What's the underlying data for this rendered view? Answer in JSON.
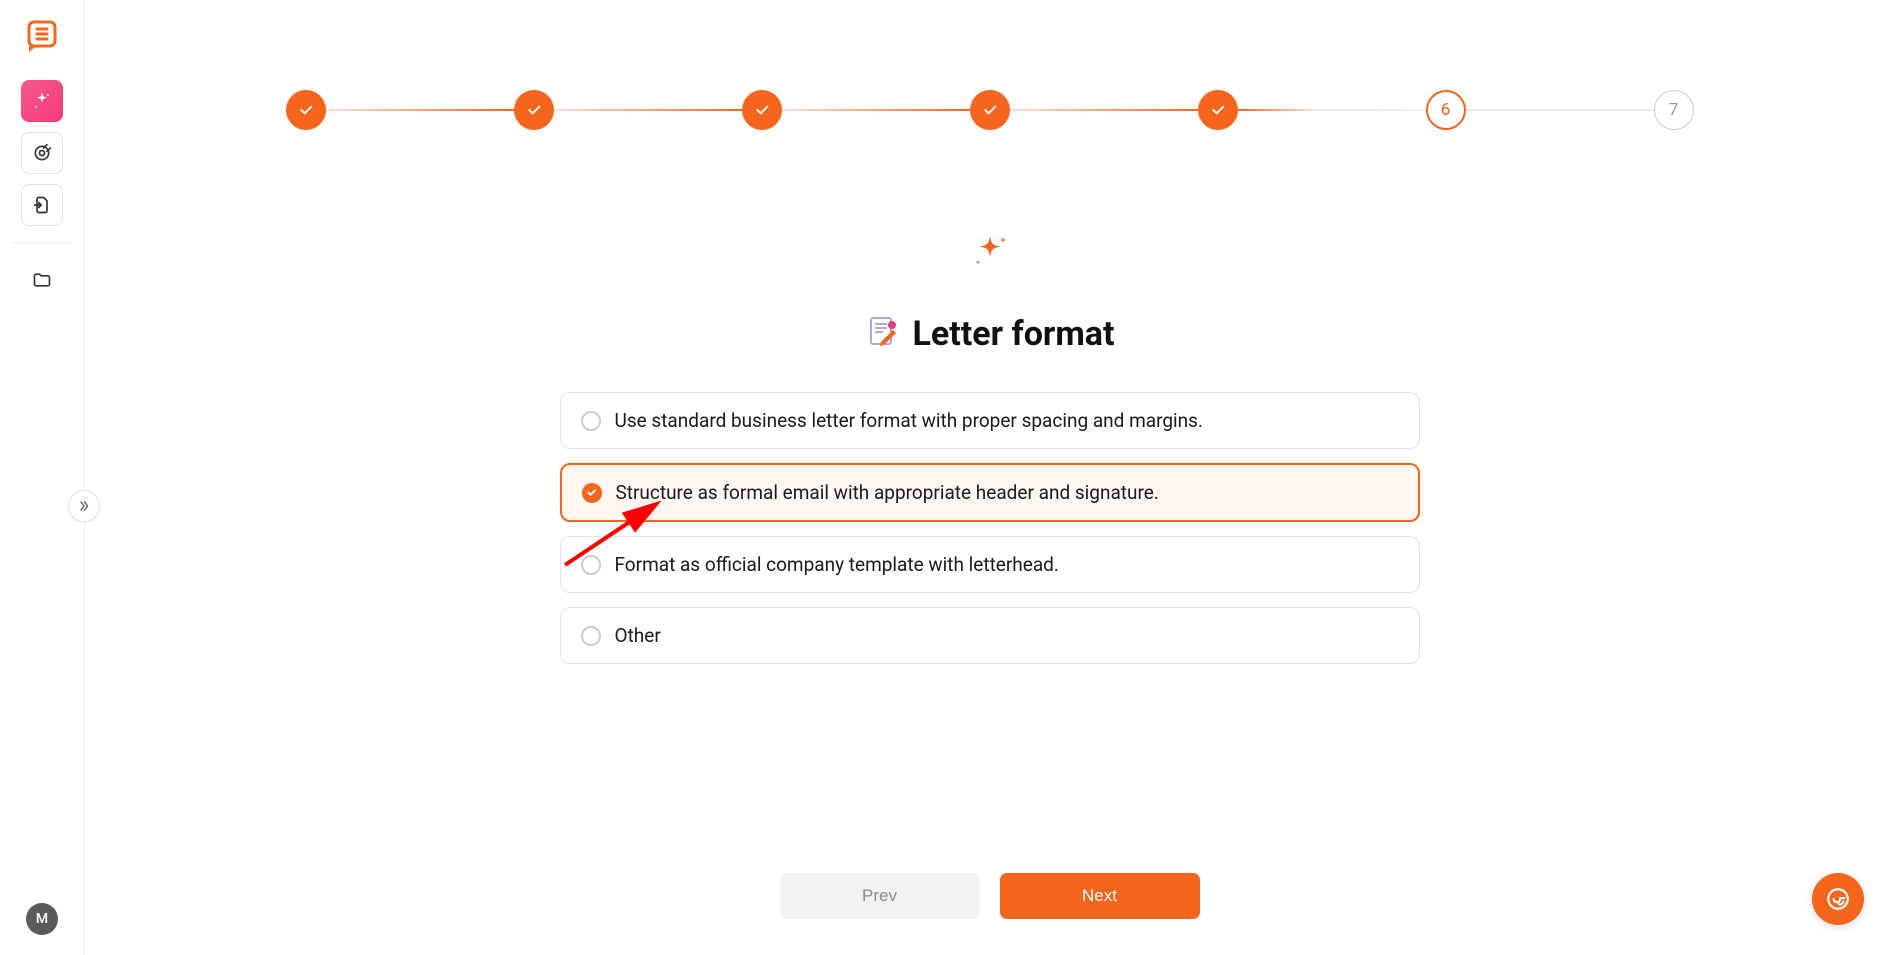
{
  "sidebar": {
    "avatar_letter": "M"
  },
  "stepper": {
    "steps": [
      "done",
      "done",
      "done",
      "done",
      "done",
      "current",
      "pending"
    ],
    "current_label": "6",
    "pending_label": "7"
  },
  "page": {
    "heading": "Letter format"
  },
  "options": [
    "Use standard business letter format with proper spacing and margins.",
    "Structure as formal email with appropriate header and signature.",
    "Format as official company template with letterhead.",
    "Other"
  ],
  "selected_index": 1,
  "buttons": {
    "prev": "Prev",
    "next": "Next"
  },
  "colors": {
    "accent": "#f5651c",
    "pink": "#f5397a"
  }
}
